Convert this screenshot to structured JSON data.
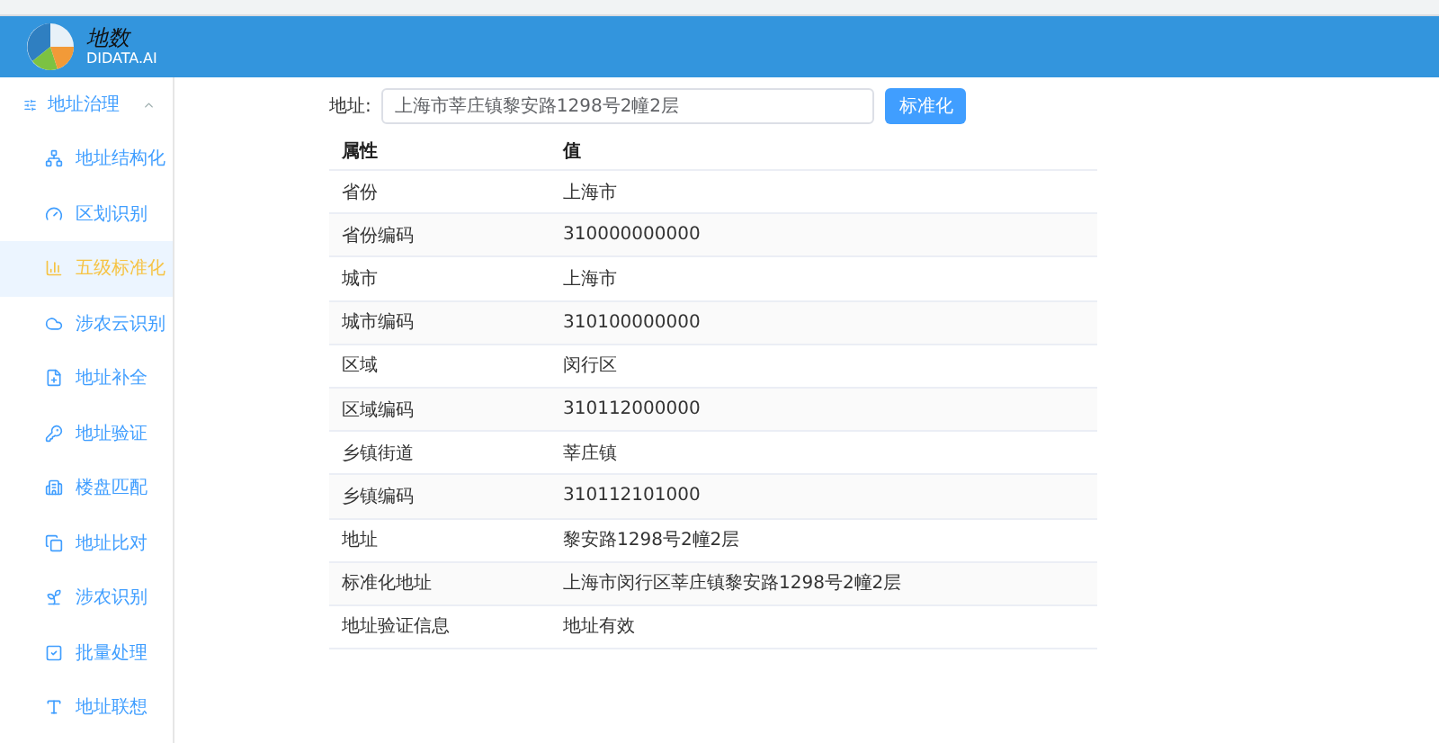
{
  "header": {
    "logo_text": "地数",
    "logo_subtext": "DIDATA.AI"
  },
  "sidebar": {
    "group": {
      "label": "地址治理",
      "expanded": true
    },
    "items": [
      {
        "label": "地址结构化",
        "selected": false
      },
      {
        "label": "区划识别",
        "selected": false
      },
      {
        "label": "五级标准化",
        "selected": true
      },
      {
        "label": "涉农云识别",
        "selected": false
      },
      {
        "label": "地址补全",
        "selected": false
      },
      {
        "label": "地址验证",
        "selected": false
      },
      {
        "label": "楼盘匹配",
        "selected": false
      },
      {
        "label": "地址比对",
        "selected": false
      },
      {
        "label": "涉农识别",
        "selected": false
      },
      {
        "label": "批量处理",
        "selected": false
      },
      {
        "label": "地址联想",
        "selected": false
      }
    ]
  },
  "form": {
    "label": "地址:",
    "value": "上海市莘庄镇黎安路1298号2幢2层",
    "button": "标准化"
  },
  "table": {
    "columns": [
      "属性",
      "值"
    ],
    "rows": [
      [
        "省份",
        "上海市"
      ],
      [
        "省份编码",
        "310000000000"
      ],
      [
        "城市",
        "上海市"
      ],
      [
        "城市编码",
        "310100000000"
      ],
      [
        "区域",
        "闵行区"
      ],
      [
        "区域编码",
        "310112000000"
      ],
      [
        "乡镇街道",
        "莘庄镇"
      ],
      [
        "乡镇编码",
        "310112101000"
      ],
      [
        "地址",
        "黎安路1298号2幢2层"
      ],
      [
        "标准化地址",
        "上海市闵行区莘庄镇黎安路1298号2幢2层"
      ],
      [
        "地址验证信息",
        "地址有效"
      ]
    ]
  }
}
